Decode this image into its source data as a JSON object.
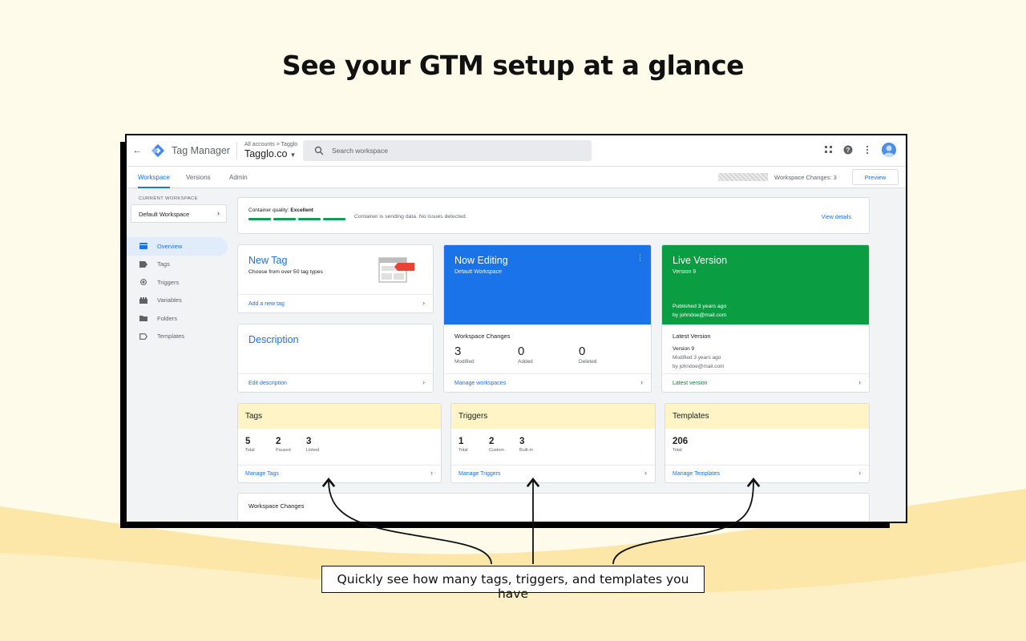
{
  "headline": "See your GTM setup at a glance",
  "callout": "Quickly see how many tags, triggers, and templates you have",
  "app": {
    "name": "Tag Manager",
    "breadcrumb": "All accounts > Tagglo",
    "account_name": "Tagglo.co",
    "search_placeholder": "Search workspace"
  },
  "tabs": [
    "Workspace",
    "Versions",
    "Admin"
  ],
  "workspace_changes_label": "Workspace Changes: 3",
  "preview_label": "Preview",
  "sidebar": {
    "current_workspace_label": "CURRENT WORKSPACE",
    "workspace_name": "Default Workspace",
    "items": [
      {
        "label": "Overview",
        "icon": "overview-icon"
      },
      {
        "label": "Tags",
        "icon": "tag-icon"
      },
      {
        "label": "Triggers",
        "icon": "trigger-icon"
      },
      {
        "label": "Variables",
        "icon": "variables-icon"
      },
      {
        "label": "Folders",
        "icon": "folder-icon"
      },
      {
        "label": "Templates",
        "icon": "template-icon"
      }
    ]
  },
  "quality": {
    "label": "Container quality:",
    "value": "Excellent",
    "message": "Container is sending data. No issues detected.",
    "link": "View details"
  },
  "new_tag": {
    "title": "New Tag",
    "subtitle": "Choose from over 50 tag types",
    "link": "Add a new tag"
  },
  "description": {
    "title": "Description",
    "link": "Edit description"
  },
  "now_editing": {
    "title": "Now Editing",
    "subtitle": "Default Workspace",
    "changes_label": "Workspace Changes",
    "stats": [
      {
        "value": "3",
        "label": "Modified"
      },
      {
        "value": "0",
        "label": "Added"
      },
      {
        "value": "0",
        "label": "Deleted"
      }
    ],
    "link": "Manage workspaces",
    "color": "#1a73e8"
  },
  "live_version": {
    "title": "Live Version",
    "subtitle": "Version 9",
    "published": "Published 3 years ago",
    "published_by": "by johndoe@mail.com",
    "latest_label": "Latest Version",
    "latest_version": "Version 9",
    "latest_modified": "Modified 3 years ago",
    "latest_by": "by johndoe@mail.com",
    "link": "Latest version",
    "color": "#0b9d41"
  },
  "summaries": [
    {
      "title": "Tags",
      "stats": [
        {
          "value": "5",
          "label": "Total"
        },
        {
          "value": "2",
          "label": "Paused"
        },
        {
          "value": "3",
          "label": "Linked"
        }
      ],
      "link": "Manage Tags"
    },
    {
      "title": "Triggers",
      "stats": [
        {
          "value": "1",
          "label": "Total"
        },
        {
          "value": "2",
          "label": "Custom"
        },
        {
          "value": "3",
          "label": "Built-in"
        }
      ],
      "link": "Manage Triggers"
    },
    {
      "title": "Templates",
      "stats": [
        {
          "value": "206",
          "label": "Total"
        }
      ],
      "link": "Manage Templates"
    }
  ],
  "workspace_changes_card": "Workspace Changes"
}
